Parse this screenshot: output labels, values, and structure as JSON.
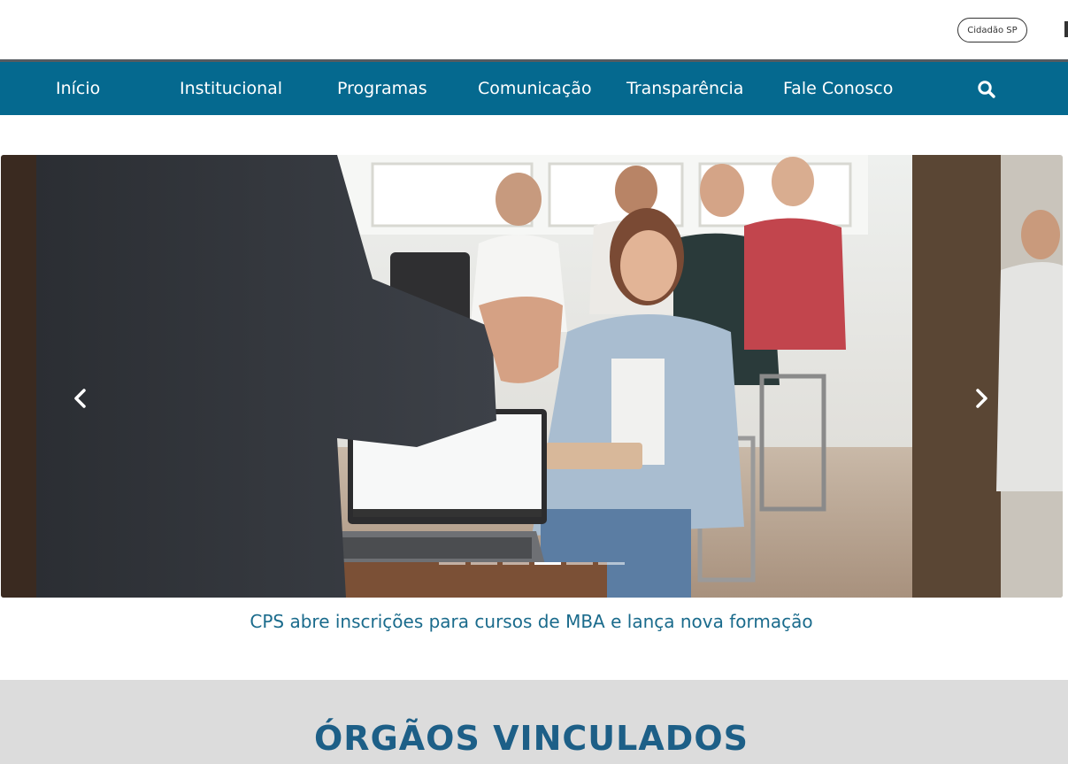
{
  "header": {
    "cidadao_label": "Cidadão SP"
  },
  "nav": {
    "items": [
      {
        "label": "Início"
      },
      {
        "label": "Institucional"
      },
      {
        "label": "Programas"
      },
      {
        "label": "Comunicação"
      },
      {
        "label": "Transparência"
      },
      {
        "label": "Fale Conosco"
      }
    ],
    "search_icon": "search-icon"
  },
  "carousel": {
    "caption": "CPS abre inscrições para cursos de MBA e lança nova formação",
    "slide_count": 6,
    "active_index": 3,
    "prev_icon": "chevron-left-icon",
    "next_icon": "chevron-right-icon"
  },
  "orgaos": {
    "title": "ÓRGÃOS VINCULADOS"
  },
  "colors": {
    "nav_bg": "#05698f",
    "nav_border": "#555b61",
    "caption": "#1a6b8c",
    "orgaos_bg": "#dcdcdc",
    "orgaos_title": "#1d5f87"
  }
}
